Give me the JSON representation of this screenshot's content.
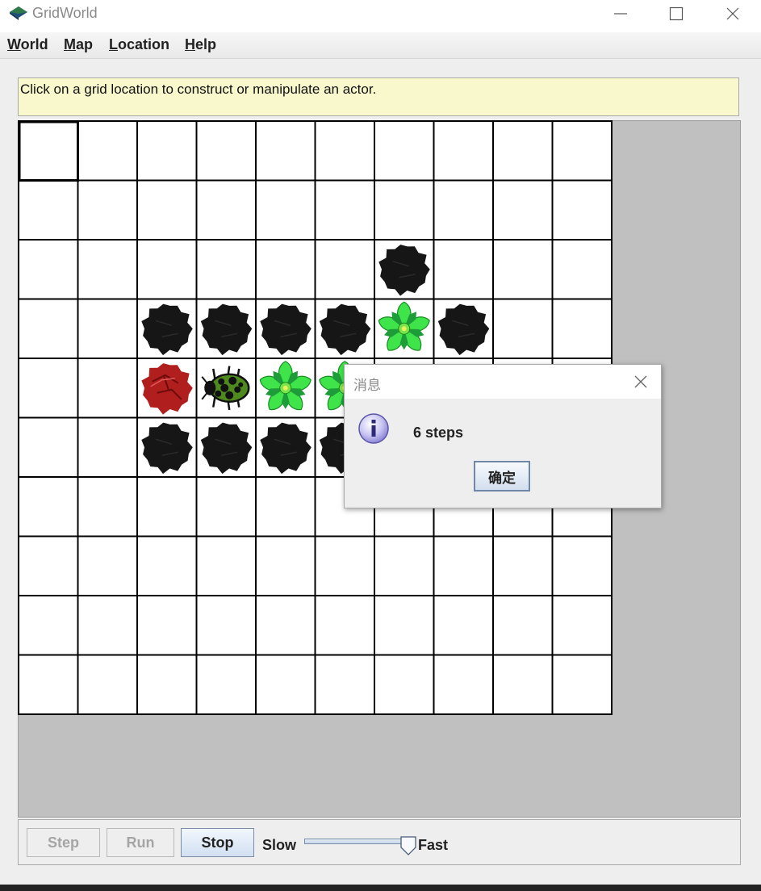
{
  "window": {
    "title": "GridWorld",
    "app_icon": "gridworld-diamond-icon",
    "controls": [
      "minimize-icon",
      "maximize-icon",
      "close-icon"
    ]
  },
  "menu": {
    "items": [
      {
        "mnemonic": "W",
        "rest": "orld"
      },
      {
        "mnemonic": "M",
        "rest": "ap"
      },
      {
        "mnemonic": "L",
        "rest": "ocation"
      },
      {
        "mnemonic": "H",
        "rest": "elp"
      }
    ]
  },
  "message_bar": {
    "text": "Click on a grid location to construct or manipulate an actor."
  },
  "grid": {
    "rows": 10,
    "cols": 10,
    "selected_cell": [
      0,
      0
    ],
    "actors": [
      {
        "type": "rock",
        "row": 2,
        "col": 6
      },
      {
        "type": "rock",
        "row": 3,
        "col": 2
      },
      {
        "type": "rock",
        "row": 3,
        "col": 3
      },
      {
        "type": "rock",
        "row": 3,
        "col": 4
      },
      {
        "type": "rock",
        "row": 3,
        "col": 5
      },
      {
        "type": "flower",
        "row": 3,
        "col": 6
      },
      {
        "type": "rock",
        "row": 3,
        "col": 7
      },
      {
        "type": "red-rock",
        "row": 4,
        "col": 2
      },
      {
        "type": "bug",
        "row": 4,
        "col": 3
      },
      {
        "type": "flower",
        "row": 4,
        "col": 4
      },
      {
        "type": "flower",
        "row": 4,
        "col": 5
      },
      {
        "type": "rock",
        "row": 5,
        "col": 2
      },
      {
        "type": "rock",
        "row": 5,
        "col": 3
      },
      {
        "type": "rock",
        "row": 5,
        "col": 4
      },
      {
        "type": "rock",
        "row": 5,
        "col": 5
      }
    ],
    "colors": {
      "rock": "#161616",
      "red_rock": "#b01e1e",
      "bug": "#4f8a1e",
      "flower": "#3ee44a",
      "background": "#c0c0c0"
    }
  },
  "controls": {
    "step_label": "Step",
    "run_label": "Run",
    "stop_label": "Stop",
    "slow_label": "Slow",
    "fast_label": "Fast",
    "speed_level": 0.92
  },
  "dialog": {
    "title": "消息",
    "message": "6 steps",
    "ok_label": "确定",
    "icon": "info-icon"
  }
}
